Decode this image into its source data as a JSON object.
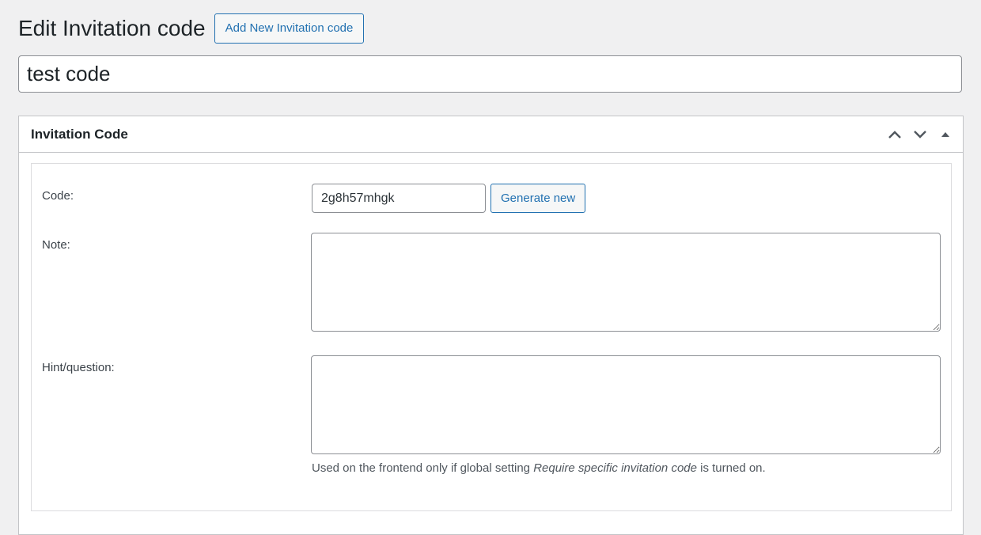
{
  "header": {
    "title": "Edit Invitation code",
    "add_new_label": "Add New Invitation code"
  },
  "post_title": {
    "value": "test code"
  },
  "metabox": {
    "title": "Invitation Code",
    "icons": [
      "chevron-up-icon",
      "chevron-down-icon",
      "caret-up-icon"
    ],
    "fields": {
      "code": {
        "label": "Code:",
        "value": "2g8h57mhgk",
        "generate_label": "Generate new"
      },
      "note": {
        "label": "Note:",
        "value": ""
      },
      "hint": {
        "label": "Hint/question:",
        "value": "",
        "description_before": "Used on the frontend only if global setting ",
        "description_setting": "Require specific invitation code",
        "description_after": " is turned on."
      }
    }
  },
  "colors": {
    "background": "#f0f0f1",
    "accent": "#2271b1",
    "border": "#c3c4c7",
    "input_border": "#8c8f94"
  }
}
